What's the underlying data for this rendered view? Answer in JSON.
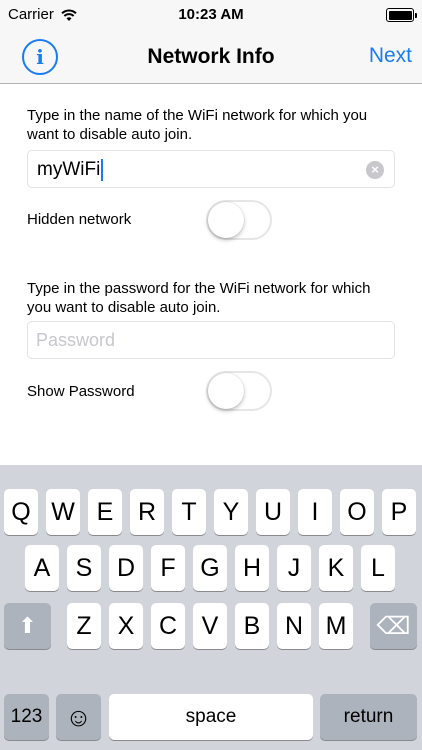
{
  "status_bar": {
    "carrier": "Carrier",
    "time": "10:23 AM"
  },
  "nav": {
    "info_label": "i",
    "title": "Network Info",
    "next_label": "Next"
  },
  "network_prompt": "Type in the name of the WiFi network for which you want to disable auto join.",
  "ssid_field": {
    "value": "myWiFi",
    "clear_label": "×"
  },
  "hidden_network": {
    "label": "Hidden network",
    "on": false
  },
  "password_prompt": "Type in the password for the WiFi network for which you want to disable auto join.",
  "password_field": {
    "placeholder": "Password",
    "value": ""
  },
  "show_password": {
    "label": "Show Password",
    "on": false
  },
  "keyboard": {
    "row1": [
      "Q",
      "W",
      "E",
      "R",
      "T",
      "Y",
      "U",
      "I",
      "O",
      "P"
    ],
    "row2": [
      "A",
      "S",
      "D",
      "F",
      "G",
      "H",
      "J",
      "K",
      "L"
    ],
    "row3": [
      "Z",
      "X",
      "C",
      "V",
      "B",
      "N",
      "M"
    ],
    "shift_icon": "⬆",
    "delete_icon": "⌫",
    "numbers_label": "123",
    "emoji_icon": "☺",
    "space_label": "space",
    "return_label": "return"
  },
  "colors": {
    "accent": "#1a7cf5",
    "keyboard_bg": "#d1d5db",
    "dark_key": "#adb3bc"
  }
}
